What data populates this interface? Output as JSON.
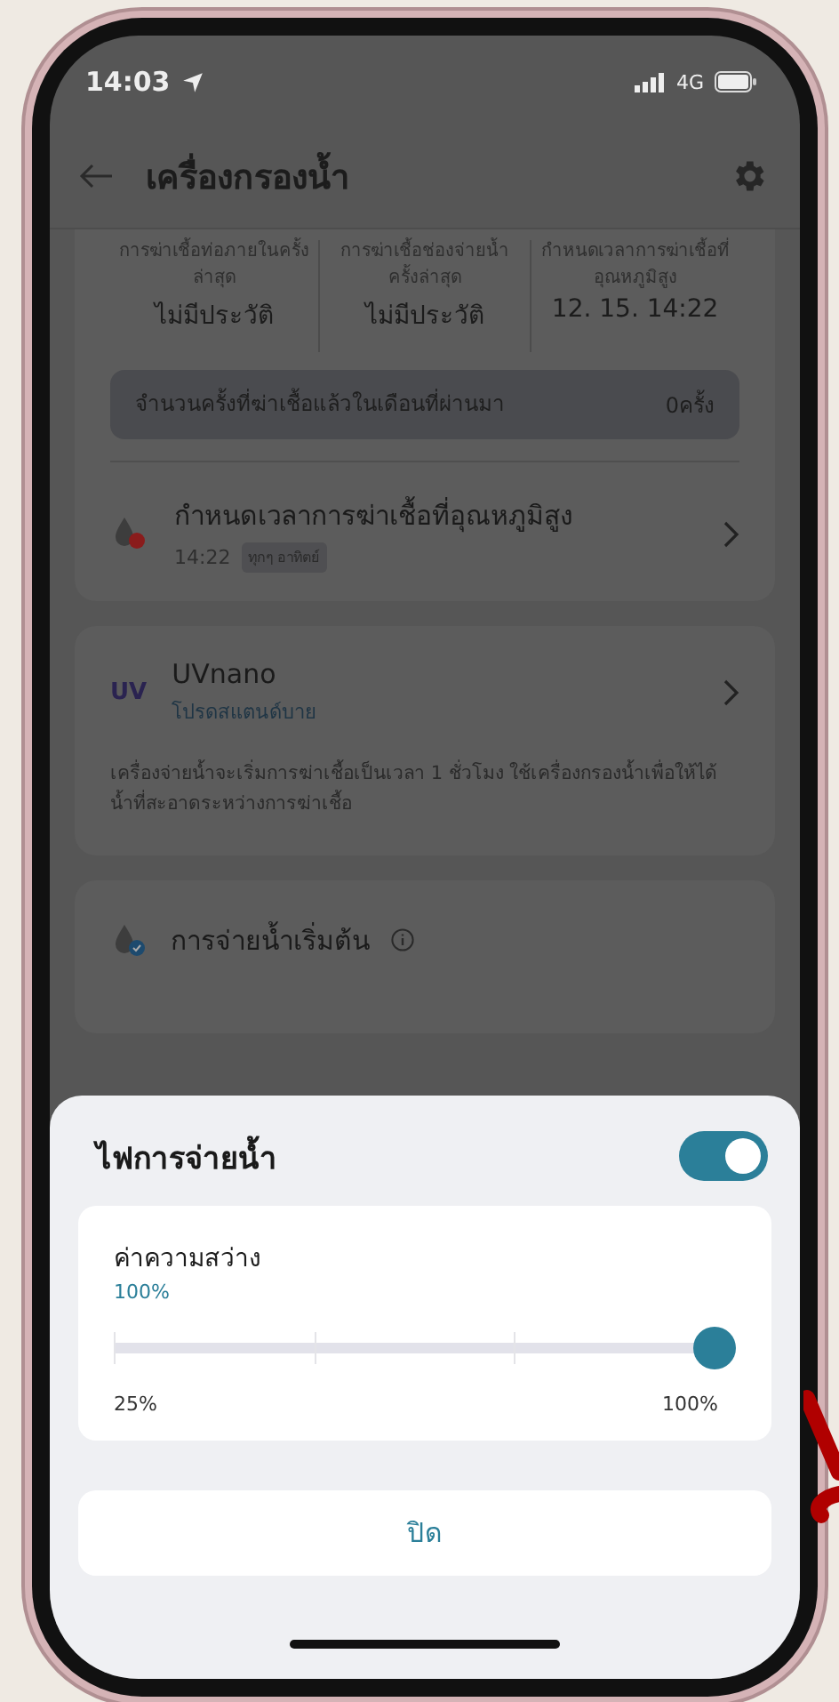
{
  "status_bar": {
    "time": "14:03",
    "network": "4G"
  },
  "header": {
    "title": "เครื่องกรองน้ำ"
  },
  "stats": [
    {
      "label": "การฆ่าเชื้อท่อภายในครั้งล่าสุด",
      "value": "ไม่มีประวัติ"
    },
    {
      "label": "การฆ่าเชื้อช่องจ่ายน้ำครั้งล่าสุด",
      "value": "ไม่มีประวัติ"
    },
    {
      "label": "กำหนดเวลาการฆ่าเชื้อที่อุณหภูมิสูง",
      "value": "12. 15. 14:22"
    }
  ],
  "monthly_count": {
    "label": "จำนวนครั้งที่ฆ่าเชื้อแล้วในเดือนที่ผ่านมา",
    "value": "0ครั้ง"
  },
  "schedule": {
    "title": "กำหนดเวลาการฆ่าเชื้อที่อุณหภูมิสูง",
    "time": "14:22",
    "tag": "ทุกๆ อาทิตย์"
  },
  "uv_card": {
    "logo": "UV",
    "title": "UVnano",
    "subtitle": "โปรดสแตนด์บาย",
    "description": "เครื่องจ่ายน้ำจะเริ่มการฆ่าเชื้อเป็นเวลา 1 ชั่วโมง ใช้เครื่องกรองน้ำเพื่อให้ได้น้ำที่สะอาดระหว่างการฆ่าเชื้อ"
  },
  "default_dispense": {
    "title": "การจ่ายน้ำเริ่มต้น"
  },
  "sheet": {
    "title": "ไฟการจ่ายน้ำ",
    "on": true,
    "brightness": {
      "label": "ค่าความสว่าง",
      "reading": "100%",
      "level": 1,
      "min_label": "25%",
      "max_label": "100%"
    },
    "close_button": "ปิด"
  }
}
